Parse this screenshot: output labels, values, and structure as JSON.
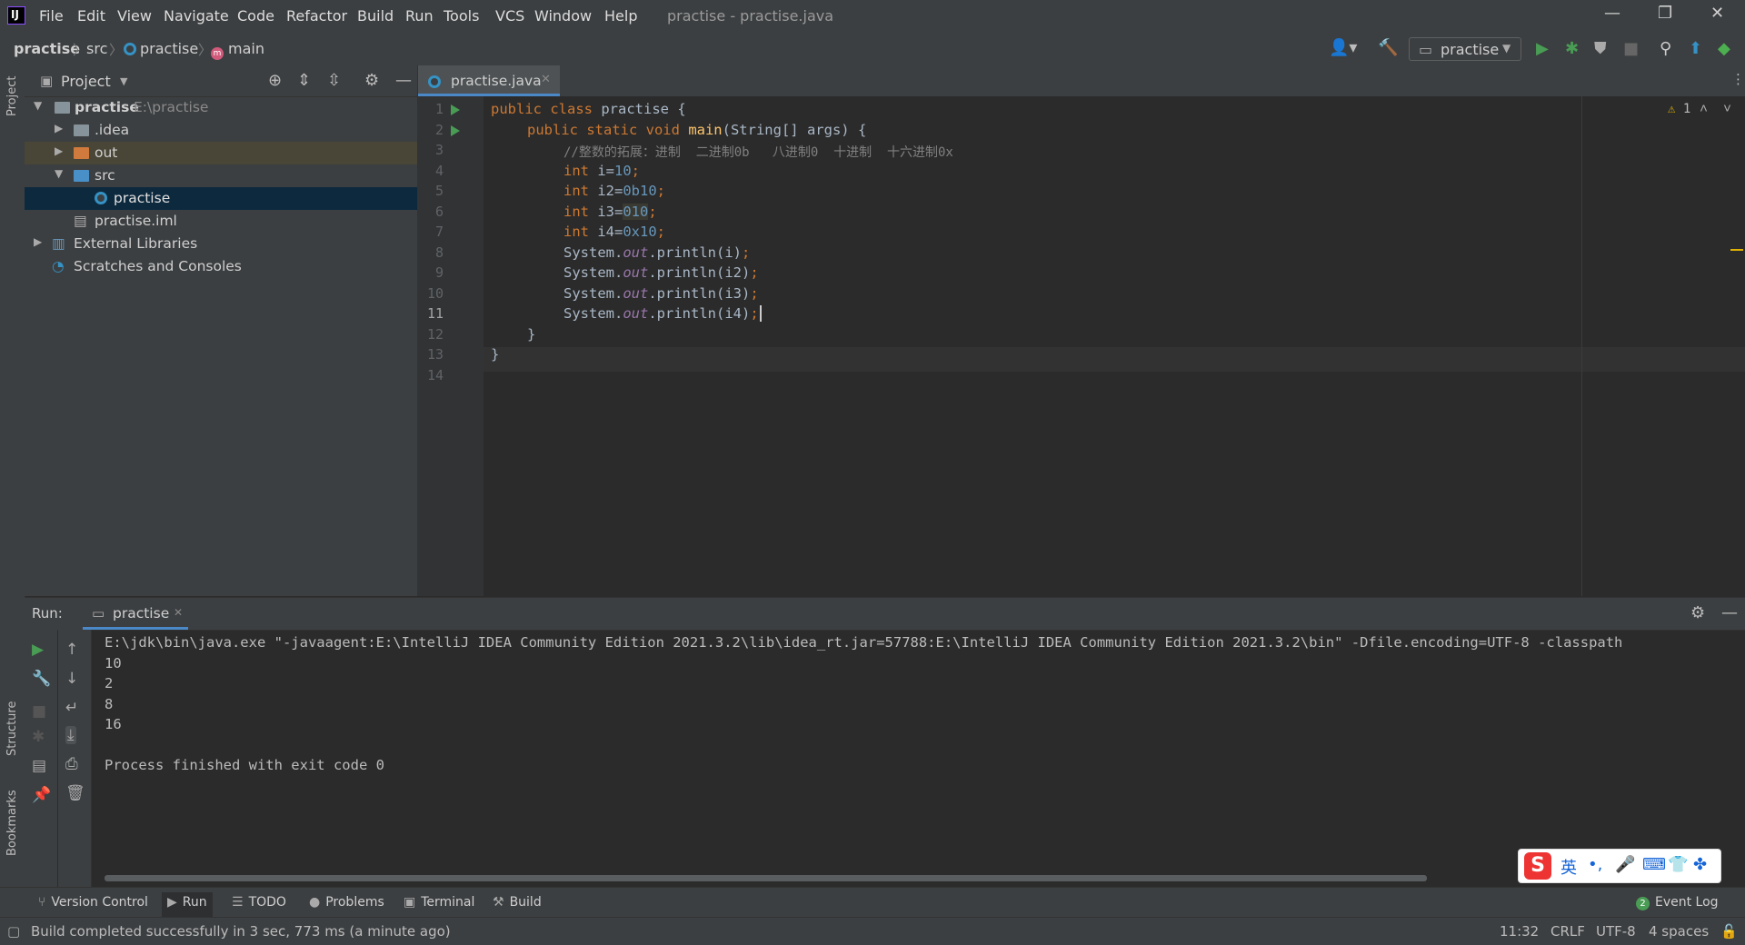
{
  "titlebar": {
    "menu": [
      "File",
      "Edit",
      "View",
      "Navigate",
      "Code",
      "Refactor",
      "Build",
      "Run",
      "Tools",
      "VCS",
      "Window",
      "Help"
    ],
    "title": "practise - practise.java",
    "minimize": "—",
    "restore": "❐",
    "close": "✕"
  },
  "breadcrumb": {
    "project": "practise",
    "folder": "src",
    "class": "practise",
    "method": "main"
  },
  "toolbar": {
    "run_config": "practise"
  },
  "left_stripe": {
    "project": "Project",
    "structure": "Structure",
    "bookmarks": "Bookmarks"
  },
  "project_panel": {
    "title": "Project",
    "tree": [
      {
        "label": "practise",
        "path": "E:\\practise"
      },
      {
        "label": ".idea"
      },
      {
        "label": "out"
      },
      {
        "label": "src"
      },
      {
        "label": "practise"
      },
      {
        "label": "practise.iml"
      },
      {
        "label": "External Libraries"
      },
      {
        "label": "Scratches and Consoles"
      }
    ]
  },
  "editor": {
    "tab": "practise.java",
    "warning_count": "1",
    "lines": [
      {
        "n": "1"
      },
      {
        "n": "2"
      },
      {
        "n": "3"
      },
      {
        "n": "4"
      },
      {
        "n": "5"
      },
      {
        "n": "6"
      },
      {
        "n": "7"
      },
      {
        "n": "8"
      },
      {
        "n": "9"
      },
      {
        "n": "10"
      },
      {
        "n": "11"
      },
      {
        "n": "12"
      },
      {
        "n": "13"
      },
      {
        "n": "14"
      }
    ],
    "code": {
      "l1_kw": "public class ",
      "l1_rest": "practise {",
      "l2_kw": "public static void ",
      "l2_fn": "main",
      "l2_rest": "(String[] args) {",
      "l3": "//整数的拓展：进制  二进制0b   八进制0  十进制  十六进制0x",
      "l4_kw": "int ",
      "l4_a": "i=",
      "l4_n": "10",
      "l4_s": ";",
      "l5_kw": "int ",
      "l5_a": "i2=",
      "l5_n": "0b10",
      "l5_s": ";",
      "l6_kw": "int ",
      "l6_a": "i3=",
      "l6_n": "010",
      "l6_s": ";",
      "l7_kw": "int ",
      "l7_a": "i4=",
      "l7_n": "0x10",
      "l7_s": ";",
      "sys": "System.",
      "out": "out",
      "println1": ".println(i)",
      "println2": ".println(i2)",
      "println3": ".println(i3)",
      "println4": ".println(i4)",
      "semi": ";",
      "l12": "}",
      "l13": "}"
    }
  },
  "run_panel": {
    "label": "Run:",
    "tab": "practise",
    "output": [
      "E:\\jdk\\bin\\java.exe \"-javaagent:E:\\IntelliJ IDEA Community Edition 2021.3.2\\lib\\idea_rt.jar=57788:E:\\IntelliJ IDEA Community Edition 2021.3.2\\bin\" -Dfile.encoding=UTF-8 -classpath",
      "10",
      "2",
      "8",
      "16",
      "",
      "Process finished with exit code 0"
    ]
  },
  "tool_strip": {
    "version_control": "Version Control",
    "run": "Run",
    "todo": "TODO",
    "problems": "Problems",
    "terminal": "Terminal",
    "build": "Build",
    "event_log_count": "2",
    "event_log": "Event Log"
  },
  "status_bar": {
    "message": "Build completed successfully in 3 sec, 773 ms (a minute ago)",
    "position": "11:32",
    "line_sep": "CRLF",
    "encoding": "UTF-8",
    "indent": "4 spaces"
  },
  "ime": {
    "mode": "英"
  }
}
